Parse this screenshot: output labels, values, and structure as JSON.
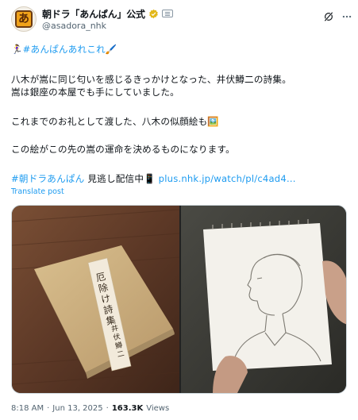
{
  "account": {
    "display_name": "朝ドラ「あんぱん」公式",
    "handle": "@asadora_nhk",
    "avatar_glyph": "あ"
  },
  "post": {
    "line1_emoji": "🏃‍♀️",
    "line1_hashtag": "#あんぱんあれこれ",
    "line1_emoji2": "🖌️",
    "para1_line1": "八木が嵩に同じ匂いを感じるきっかけとなった、井伏鱒二の詩集。",
    "para1_line2": "嵩は銀座の本屋でも手にしていました。",
    "para2": "これまでのお礼として渡した、八木の似顔絵も🖼️",
    "para3": "この絵がこの先の嵩の運命を決めるものになります。",
    "footer_hashtag": "#朝ドラあんぱん",
    "footer_text": " 見逃し配信中",
    "footer_emoji": "📱",
    "footer_link": "plus.nhk.jp/watch/pl/c4ad4..."
  },
  "translate_label": "Translate post",
  "media": {
    "book_title": "厄除け詩集",
    "book_author": "井伏鱒二"
  },
  "meta": {
    "time": "8:18 AM",
    "separator": "·",
    "date": "Jun 13, 2025",
    "separator2": "·",
    "views_count": "163.3K",
    "views_label": "Views"
  },
  "colors": {
    "accent": "#1d9bf0",
    "verified_gold": "#e2b719",
    "text_secondary": "#536471"
  },
  "icons": [
    "avatar-logo",
    "verified-badge-icon",
    "affiliate-badge-icon",
    "grok-icon",
    "more-icon"
  ]
}
